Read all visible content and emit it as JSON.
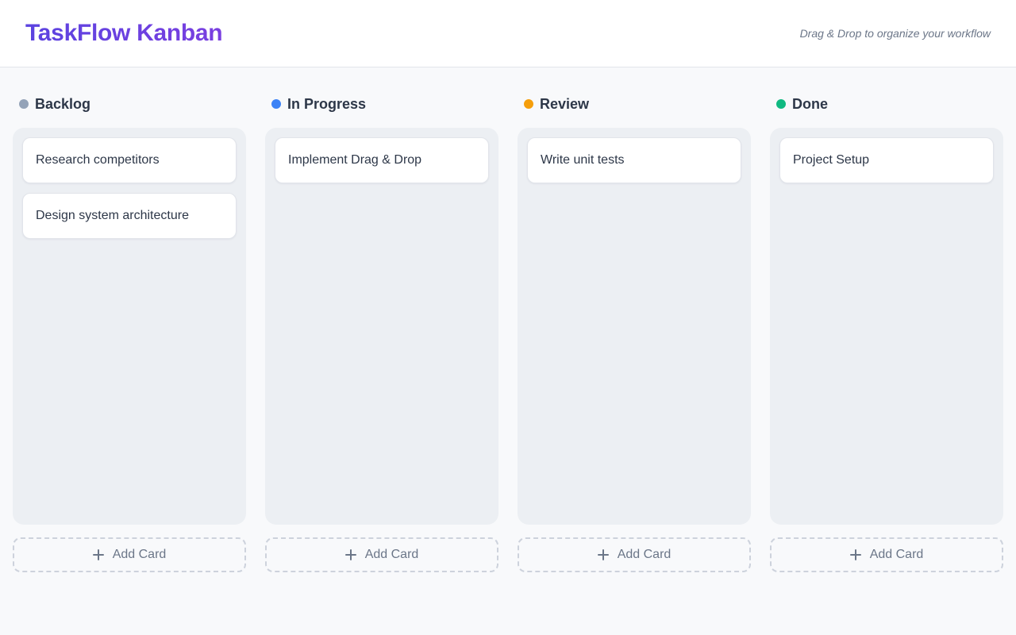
{
  "header": {
    "title": "TaskFlow Kanban",
    "tagline": "Drag & Drop to organize your workflow"
  },
  "columns": [
    {
      "title": "Backlog",
      "dot_color": "#94a3b8",
      "cards": [
        "Research competitors",
        "Design system architecture"
      ],
      "add_label": "Add Card"
    },
    {
      "title": "In Progress",
      "dot_color": "#3b82f6",
      "cards": [
        "Implement Drag & Drop"
      ],
      "add_label": "Add Card"
    },
    {
      "title": "Review",
      "dot_color": "#f59e0b",
      "cards": [
        "Write unit tests"
      ],
      "add_label": "Add Card"
    },
    {
      "title": "Done",
      "dot_color": "#10b981",
      "cards": [
        "Project Setup"
      ],
      "add_label": "Add Card"
    }
  ],
  "icons": {
    "add": "plus-icon",
    "status": "status-dot-icon"
  }
}
